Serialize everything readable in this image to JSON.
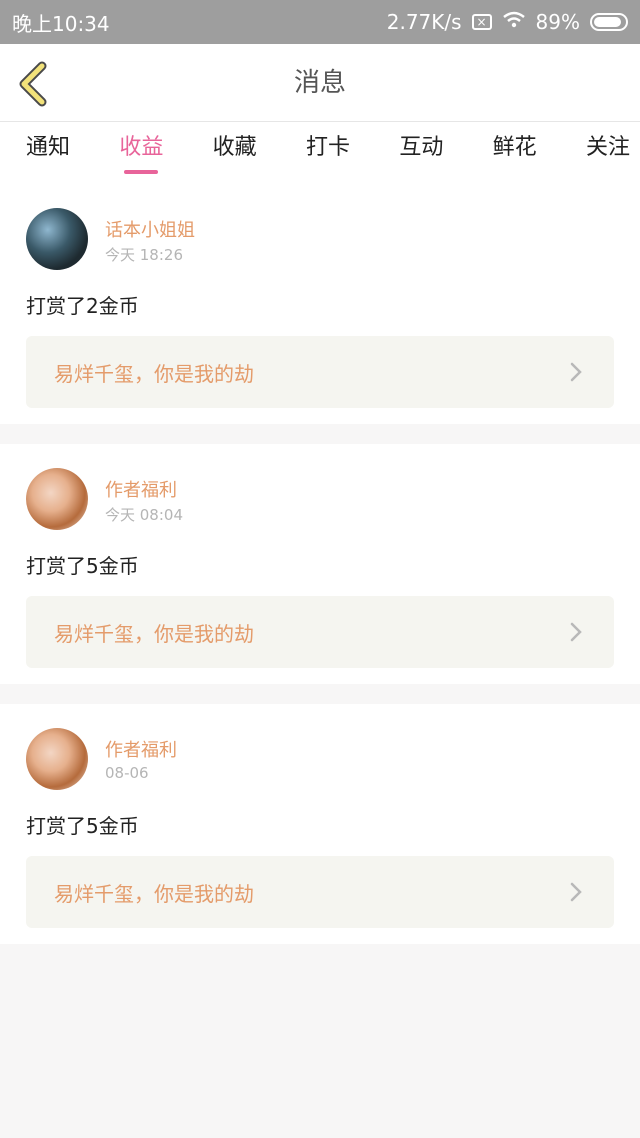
{
  "status": {
    "time": "晚上10:34",
    "speed": "2.77K/s",
    "battery": "89%"
  },
  "header": {
    "title": "消息"
  },
  "tabs": [
    {
      "label": "通知",
      "active": false
    },
    {
      "label": "收益",
      "active": true
    },
    {
      "label": "收藏",
      "active": false
    },
    {
      "label": "打卡",
      "active": false
    },
    {
      "label": "互动",
      "active": false
    },
    {
      "label": "鲜花",
      "active": false
    },
    {
      "label": "关注",
      "active": false
    }
  ],
  "messages": [
    {
      "user": "话本小姐姐",
      "time": "今天 18:26",
      "text": "打赏了2金币",
      "book": "易烊千玺，你是我的劫"
    },
    {
      "user": "作者福利",
      "time": "今天 08:04",
      "text": "打赏了5金币",
      "book": "易烊千玺，你是我的劫"
    },
    {
      "user": "作者福利",
      "time": "08-06",
      "text": "打赏了5金币",
      "book": "易烊千玺，你是我的劫"
    }
  ],
  "colors": {
    "accent": "#e8649a",
    "name": "#e49b6a",
    "statusbar": "#9e9e9e"
  }
}
